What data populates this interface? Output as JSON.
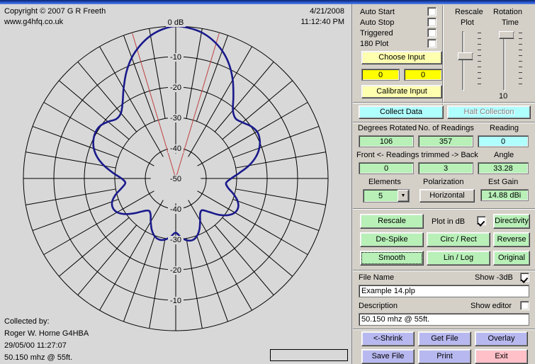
{
  "header": {
    "copyright": "Copyright © 2007 G R Freeth",
    "website": "www.g4hfq.co.uk",
    "date": "4/21/2008",
    "time": "11:12:40 PM"
  },
  "footer": {
    "collected_by_label": "Collected by:",
    "operator": "Roger W. Horne G4HBA",
    "timestamp": "29/05/00 11:27:07",
    "frequency": "50.150 mhz @ 55ft.",
    "status_box_value": ""
  },
  "options": {
    "checkboxes": [
      {
        "label": "Auto Start",
        "checked": false
      },
      {
        "label": "Auto Stop",
        "checked": false
      },
      {
        "label": "Triggered",
        "checked": false
      },
      {
        "label": "180 Plot",
        "checked": false
      }
    ],
    "choose_input": "Choose Input",
    "input_a": "0",
    "input_b": "0",
    "calibrate_input": "Calibrate Input"
  },
  "sliders": {
    "rescale_plot_label_line1": "Rescale",
    "rescale_plot_label_line2": "Plot",
    "rotation_time_label_line1": "Rotation",
    "rotation_time_label_line2": "Time",
    "rotation_time_value": "10"
  },
  "collection": {
    "collect_data": "Collect Data",
    "halt_collection": "Halt Collection"
  },
  "readings": {
    "degrees_rotated_label": "Degrees Rotated",
    "degrees_rotated_value": "106",
    "no_of_readings_label": "No. of Readings",
    "no_of_readings_value": "357",
    "reading_label": "Reading",
    "reading_value": "0",
    "trimmed_label": "Front <- Readings trimmed -> Back",
    "trimmed_front_value": "0",
    "trimmed_back_value": "3",
    "angle_label": "Angle",
    "angle_value": "33.28",
    "elements_label": "Elements",
    "elements_value": "5",
    "polarization_label": "Polarization",
    "polarization_value": "Horizontal",
    "est_gain_label": "Est Gain",
    "est_gain_value": "14.88 dBi"
  },
  "tools": {
    "rescale": "Rescale",
    "plot_in_db_label": "Plot in dB",
    "plot_in_db_checked": true,
    "directivity": "Directivity",
    "de_spike": "De-Spike",
    "circ_rect": "Circ / Rect",
    "reverse": "Reverse",
    "smooth": "Smooth",
    "lin_log": "Lin / Log",
    "original": "Original"
  },
  "file": {
    "file_name_label": "File Name",
    "show_3db_label": "Show -3dB",
    "show_3db_checked": true,
    "file_name_value": "Example 14.plp",
    "description_label": "Description",
    "show_editor_label": "Show editor",
    "show_editor_checked": false,
    "description_value": "50.150 mhz @ 55ft."
  },
  "actions": {
    "shrink": "<-Shrink",
    "get_file": "Get File",
    "overlay": "Overlay",
    "save_file": "Save File",
    "print": "Print",
    "exit": "Exit"
  },
  "chart_data": {
    "type": "line",
    "subtype": "polar-radiation-pattern",
    "title": "0 dB",
    "ring_labels": [
      "0 dB",
      "-10",
      "-20",
      "-30",
      "-40",
      "-50"
    ],
    "ring_labels_lower": [
      "-40",
      "-30",
      "-20",
      "-10"
    ],
    "radial_min_db": -50,
    "radial_max_db": 0,
    "grid": true,
    "grid_rings": 5,
    "grid_spokes": 36,
    "trace_color": "#1a1a8c",
    "beamwidth_marker_color": "#c04040",
    "beamwidth_deg": 33.28,
    "est_gain_dbi": 14.88,
    "angles_deg": [
      0,
      5,
      10,
      15,
      20,
      25,
      30,
      35,
      40,
      45,
      50,
      55,
      60,
      65,
      70,
      75,
      80,
      85,
      90,
      95,
      100,
      105,
      110,
      115,
      120,
      125,
      130,
      135,
      140,
      145,
      150,
      155,
      160,
      165,
      170,
      175,
      180,
      185,
      190,
      195,
      200,
      205,
      210,
      215,
      220,
      225,
      230,
      235,
      240,
      245,
      250,
      255,
      260,
      265,
      270,
      275,
      280,
      285,
      290,
      295,
      300,
      305,
      310,
      315,
      320,
      325,
      330,
      335,
      340,
      345,
      350,
      355
    ],
    "values_db": [
      0,
      -0.4,
      -1.3,
      -3.0,
      -5.4,
      -8.6,
      -12.6,
      -17.0,
      -20.8,
      -22.2,
      -21.4,
      -20.0,
      -19.2,
      -19.6,
      -20.8,
      -22.8,
      -25.6,
      -29.0,
      -31.8,
      -33.4,
      -32.6,
      -30.4,
      -28.4,
      -27.4,
      -27.6,
      -29.0,
      -31.4,
      -34.4,
      -36.4,
      -36.0,
      -34.0,
      -31.6,
      -29.8,
      -29.0,
      -29.4,
      -30.6,
      -32.2,
      -30.8,
      -29.6,
      -29.2,
      -29.8,
      -31.4,
      -33.6,
      -35.6,
      -36.2,
      -34.8,
      -32.2,
      -29.6,
      -27.8,
      -27.2,
      -27.8,
      -29.6,
      -32.0,
      -33.4,
      -32.2,
      -29.4,
      -26.2,
      -23.4,
      -21.4,
      -20.2,
      -19.6,
      -19.8,
      -21.0,
      -22.4,
      -22.0,
      -19.6,
      -15.8,
      -11.6,
      -7.8,
      -4.8,
      -2.4,
      -0.8
    ]
  }
}
